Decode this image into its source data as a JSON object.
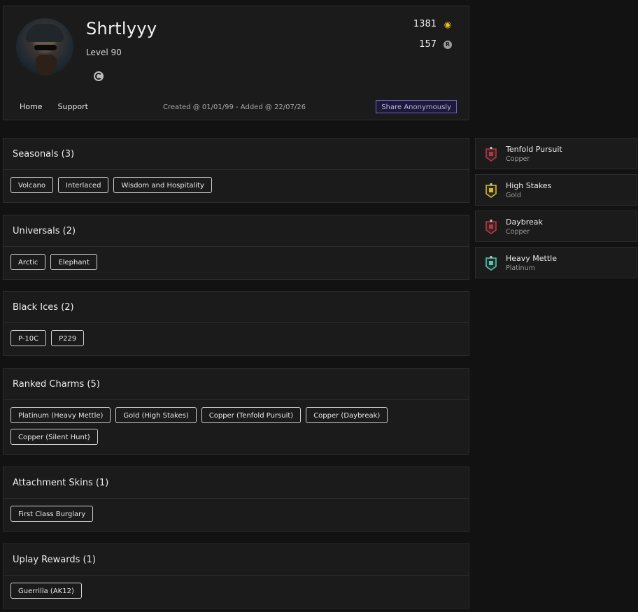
{
  "profile": {
    "username": "Shrtlyyy",
    "level": "Level 90",
    "stat1": "1381",
    "stat2": "157",
    "nav": [
      "Home",
      "Support"
    ],
    "created": "Created @ 01/01/99 - Added @ 22/07/26",
    "share_label": "Share Anonymously"
  },
  "sections": [
    {
      "title": "Seasonals (3)",
      "items": [
        "Volcano",
        "Interlaced",
        "Wisdom and Hospitality"
      ]
    },
    {
      "title": "Universals (2)",
      "items": [
        "Arctic",
        "Elephant"
      ]
    },
    {
      "title": "Black Ices (2)",
      "items": [
        "P-10C",
        "P229"
      ]
    },
    {
      "title": "Ranked Charms (5)",
      "items": [
        "Platinum (Heavy Mettle)",
        "Gold (High Stakes)",
        "Copper (Tenfold Pursuit)",
        "Copper (Daybreak)",
        "Copper (Silent Hunt)"
      ]
    },
    {
      "title": "Attachment Skins (1)",
      "items": [
        "First Class Burglary"
      ]
    },
    {
      "title": "Uplay Rewards (1)",
      "items": [
        "Guerrilla (AK12)"
      ]
    }
  ],
  "charms": [
    {
      "name": "Tenfold Pursuit",
      "tier": "Copper",
      "color": "#c0323a"
    },
    {
      "name": "High Stakes",
      "tier": "Gold",
      "color": "#d8b82a"
    },
    {
      "name": "Daybreak",
      "tier": "Copper",
      "color": "#c0323a"
    },
    {
      "name": "Heavy Mettle",
      "tier": "Platinum",
      "color": "#4fc8b8"
    }
  ]
}
